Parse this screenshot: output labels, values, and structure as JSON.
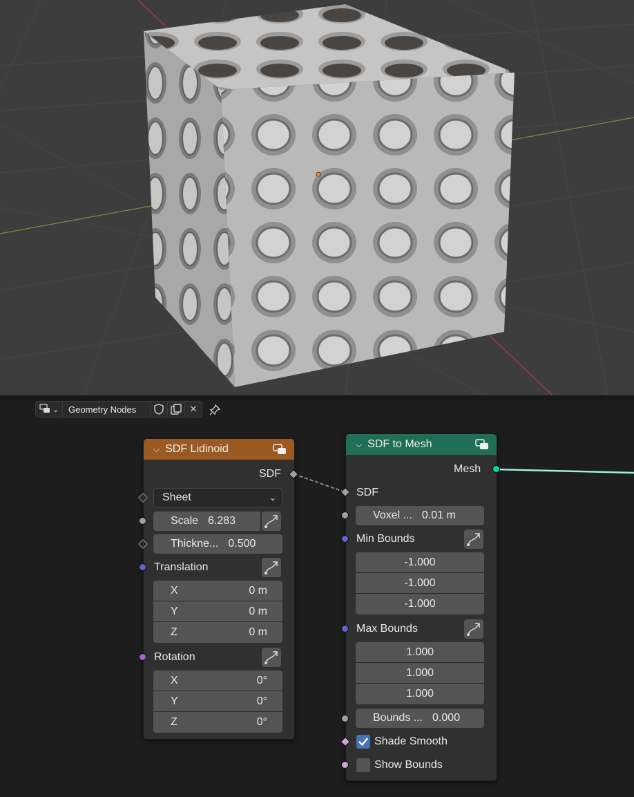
{
  "header": {
    "tree_type_icon": "node-tree-icon",
    "tree_name": "Geometry Nodes",
    "fake_user_icon": "shield-icon",
    "duplicate_icon": "duplicate-icon",
    "unlink_icon": "close-icon",
    "pin_icon": "pin-icon"
  },
  "lidinoid": {
    "title": "SDF Lidinoid",
    "header_color": "#9a5a22",
    "sdf_out": "SDF",
    "mode": "Sheet",
    "scale_label": "Scale",
    "scale_value": "6.283",
    "thickness_label": "Thickne...",
    "thickness_value": "0.500",
    "translation_label": "Translation",
    "translation": [
      {
        "axis": "X",
        "value": "0 m"
      },
      {
        "axis": "Y",
        "value": "0 m"
      },
      {
        "axis": "Z",
        "value": "0 m"
      }
    ],
    "rotation_label": "Rotation",
    "rotation": [
      {
        "axis": "X",
        "value": "0°"
      },
      {
        "axis": "Y",
        "value": "0°"
      },
      {
        "axis": "Z",
        "value": "0°"
      }
    ]
  },
  "to_mesh": {
    "title": "SDF to Mesh",
    "header_color": "#1f6e55",
    "mesh_out": "Mesh",
    "sdf_in": "SDF",
    "voxel_label": "Voxel ...",
    "voxel_value": "0.01 m",
    "min_bounds_label": "Min Bounds",
    "min_bounds": [
      "-1.000",
      "-1.000",
      "-1.000"
    ],
    "max_bounds_label": "Max Bounds",
    "max_bounds": [
      "1.000",
      "1.000",
      "1.000"
    ],
    "bounds_pad_label": "Bounds ...",
    "bounds_pad_value": "0.000",
    "shade_smooth_label": "Shade Smooth",
    "shade_smooth": true,
    "show_bounds_label": "Show Bounds",
    "show_bounds": false
  },
  "colors": {
    "float_socket": "#a1a1a1",
    "vector_socket": "#6363c7",
    "rotation_socket": "#a363c7",
    "geometry_socket": "#00d6a3",
    "bool_socket": "#cca6d6",
    "link": "#9ef0d9"
  }
}
